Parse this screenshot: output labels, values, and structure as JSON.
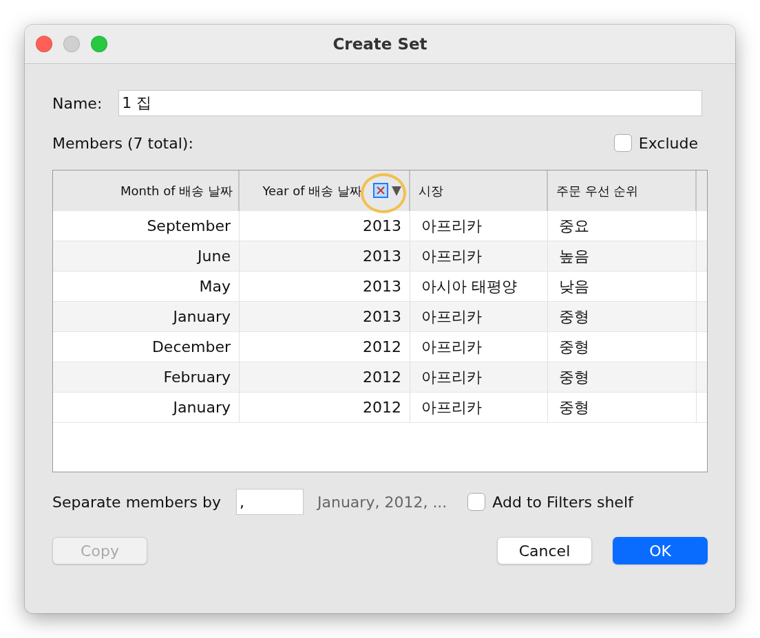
{
  "window": {
    "title": "Create Set"
  },
  "name_field": {
    "label": "Name:",
    "value": "1 집"
  },
  "members_label": "Members (7 total):",
  "exclude": {
    "label": "Exclude",
    "checked": false
  },
  "table": {
    "columns": [
      {
        "label": "Month of 배송 날짜",
        "filter_icon": false
      },
      {
        "label": "Year of 배송 날짜",
        "filter_icon": true
      },
      {
        "label": "시장",
        "filter_icon": false
      },
      {
        "label": "주문 우선 순위",
        "filter_icon": false
      }
    ],
    "rows": [
      [
        "September",
        "2013",
        "아프리카",
        "중요"
      ],
      [
        "June",
        "2013",
        "아프리카",
        "높음"
      ],
      [
        "May",
        "2013",
        "아시아 태평양",
        "낮음"
      ],
      [
        "January",
        "2013",
        "아프리카",
        "중형"
      ],
      [
        "December",
        "2012",
        "아프리카",
        "중형"
      ],
      [
        "February",
        "2012",
        "아프리카",
        "중형"
      ],
      [
        "January",
        "2012",
        "아프리카",
        "중형"
      ]
    ]
  },
  "separator": {
    "label": "Separate members by",
    "value": ",",
    "preview": "January, 2012, ..."
  },
  "add_to_filters": {
    "label": "Add to Filters shelf",
    "checked": false
  },
  "buttons": [
    {
      "label": "Copy",
      "kind": "secondary",
      "disabled": true
    },
    {
      "label": "Cancel",
      "kind": "secondary",
      "disabled": false
    },
    {
      "label": "OK",
      "kind": "primary",
      "disabled": false
    }
  ]
}
